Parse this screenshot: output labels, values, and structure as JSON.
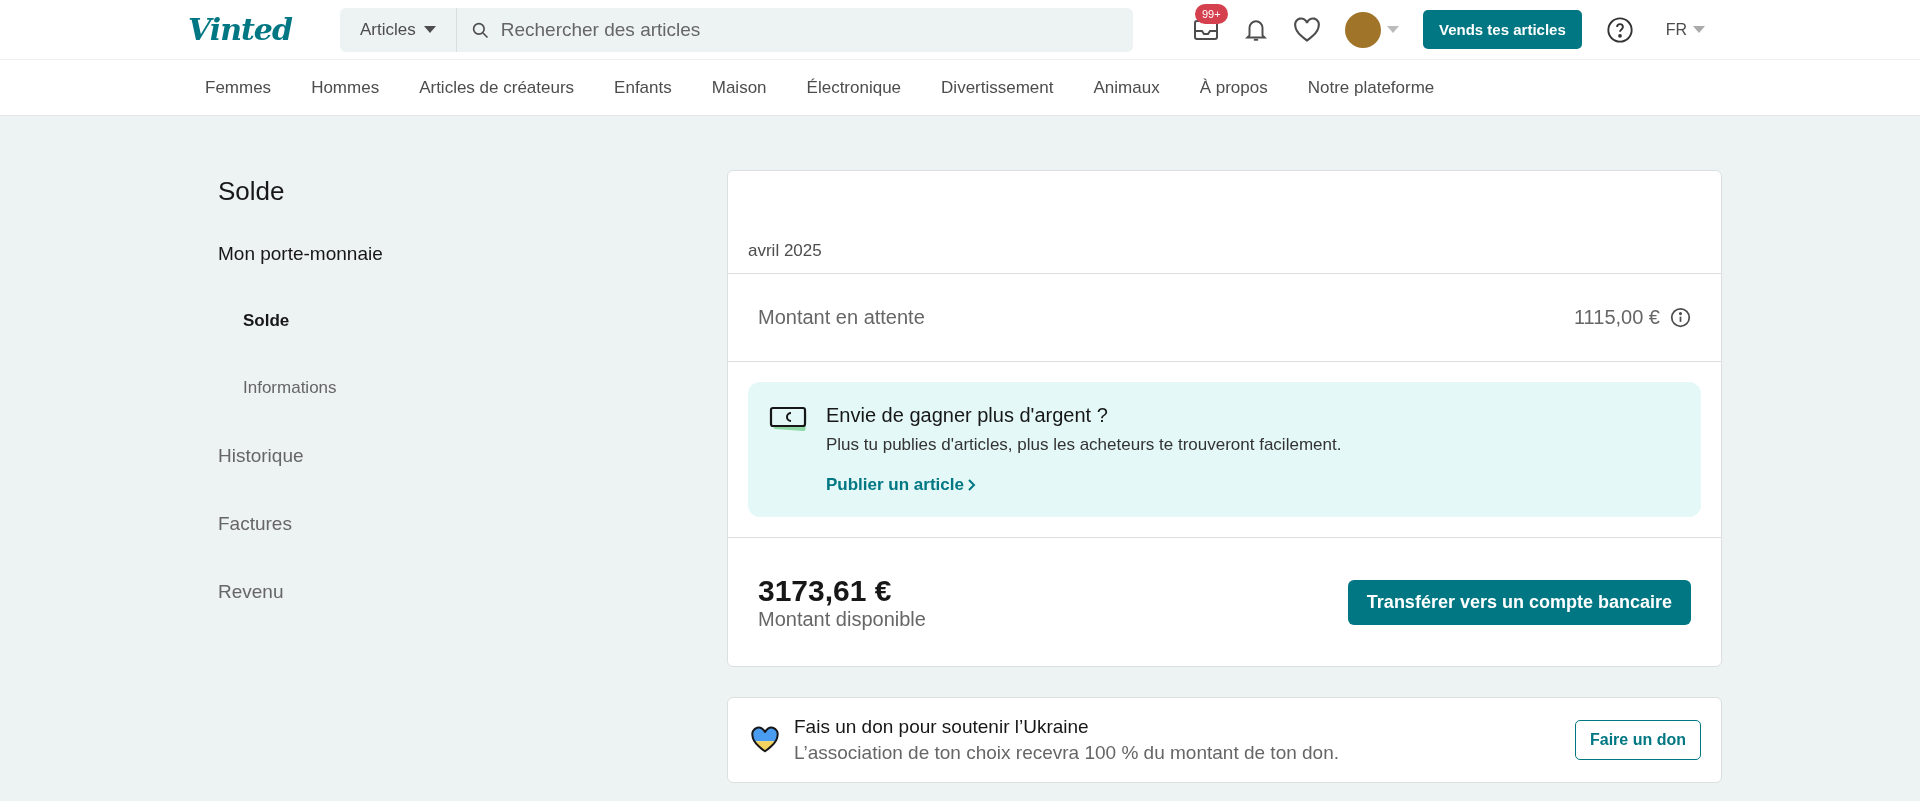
{
  "header": {
    "logo": "Vinted",
    "search_scope": "Articles",
    "search": {
      "placeholder": "Rechercher des articles"
    },
    "inbox_badge": "99+",
    "sell_button": "Vends tes articles",
    "language": "FR"
  },
  "categories": [
    "Femmes",
    "Hommes",
    "Articles de créateurs",
    "Enfants",
    "Maison",
    "Électronique",
    "Divertissement",
    "Animaux",
    "À propos",
    "Notre plateforme"
  ],
  "sidebar": {
    "title": "Solde",
    "items": [
      {
        "label": "Mon porte-monnaie",
        "expanded": true,
        "children": [
          {
            "label": "Solde",
            "selected": true
          },
          {
            "label": "Informations",
            "selected": false
          }
        ]
      },
      {
        "label": "Historique",
        "expanded": false
      },
      {
        "label": "Factures",
        "expanded": false
      },
      {
        "label": "Revenu",
        "expanded": false
      }
    ]
  },
  "balance": {
    "period": "avril 2025",
    "pending_label": "Montant en attente",
    "pending_amount": "1115,00 €",
    "promo": {
      "title": "Envie de gagner plus d'argent ?",
      "text": "Plus tu publies d'articles, plus les acheteurs te trouveront facilement.",
      "link": "Publier un article"
    },
    "available_amount": "3173,61 €",
    "available_label": "Montant disponible",
    "transfer_button": "Transférer vers un compte bancaire"
  },
  "donation": {
    "title": "Fais un don pour soutenir l’Ukraine",
    "text": "L’association de ton choix recevra 100 % du montant de ton don.",
    "button": "Faire un don"
  }
}
